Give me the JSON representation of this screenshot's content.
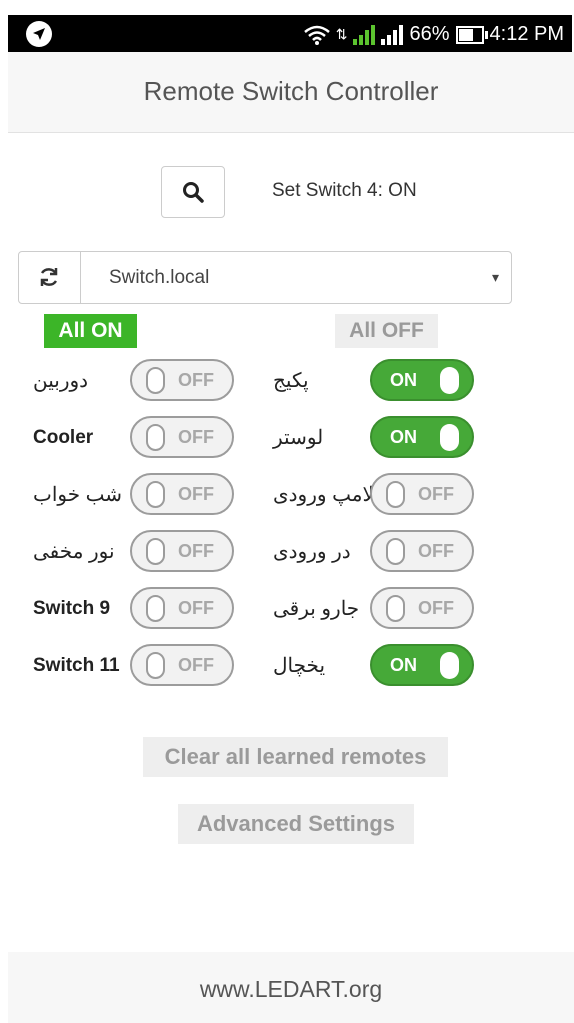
{
  "status_bar": {
    "signal_1": "1",
    "signal_2": "2",
    "battery": "66%",
    "time": "4:12 PM",
    "icons": [
      "navigation-icon",
      "wifi-icon",
      "signal-icon",
      "battery-icon"
    ]
  },
  "header": {
    "title": "Remote Switch Controller"
  },
  "command_status": "Set Switch 4: ON",
  "host": {
    "selected": "Switch.local",
    "arrow": "▾"
  },
  "all_on_label": "All ON",
  "all_off_label": "All OFF",
  "switches": [
    {
      "left": {
        "label": "دوربین",
        "state": "OFF"
      },
      "right": {
        "label": "پکیج",
        "state": "ON"
      }
    },
    {
      "left": {
        "label": "Cooler",
        "state": "OFF"
      },
      "right": {
        "label": "لوستر",
        "state": "ON"
      }
    },
    {
      "left": {
        "label": "شب خواب",
        "state": "OFF"
      },
      "right": {
        "label": "لامپ ورودی",
        "state": "OFF"
      }
    },
    {
      "left": {
        "label": "نور مخفی",
        "state": "OFF"
      },
      "right": {
        "label": "در ورودی",
        "state": "OFF"
      }
    },
    {
      "left": {
        "label": "Switch 9",
        "state": "OFF"
      },
      "right": {
        "label": "جارو برقی",
        "state": "OFF"
      }
    },
    {
      "left": {
        "label": "Switch 11",
        "state": "OFF"
      },
      "right": {
        "label": "یخچال",
        "state": "ON"
      }
    }
  ],
  "clear_button": "Clear all learned remotes",
  "advanced_button": "Advanced Settings",
  "footer": "www.LEDART.org",
  "colors": {
    "on_green": "#46a938",
    "all_on_green": "#3cb528",
    "off_grey": "#9c9c9c",
    "header_bg": "#f7f7f7"
  }
}
